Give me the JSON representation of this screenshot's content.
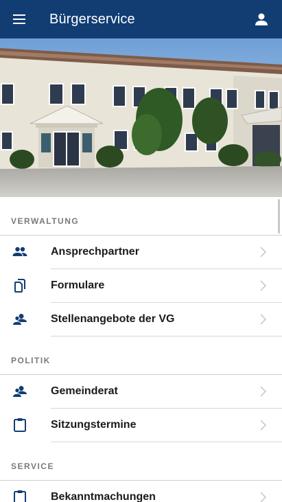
{
  "appbar": {
    "title": "Bürgerservice",
    "menu_icon": "menu-icon",
    "account_icon": "account-icon",
    "background": "#113d73"
  },
  "sections": [
    {
      "header": "VERWALTUNG",
      "items": [
        {
          "label": "Ansprechpartner",
          "icon": "people-icon"
        },
        {
          "label": "Formulare",
          "icon": "document-icon"
        },
        {
          "label": "Stellenangebote der VG",
          "icon": "group-icon"
        }
      ]
    },
    {
      "header": "POLITIK",
      "items": [
        {
          "label": "Gemeinderat",
          "icon": "group-icon"
        },
        {
          "label": "Sitzungstermine",
          "icon": "clipboard-icon"
        }
      ]
    },
    {
      "header": "SERVICE",
      "items": [
        {
          "label": "Bekanntmachungen",
          "icon": "clipboard-icon"
        }
      ]
    }
  ],
  "colors": {
    "accent": "#113d73",
    "section_header": "#7a7a7a"
  }
}
